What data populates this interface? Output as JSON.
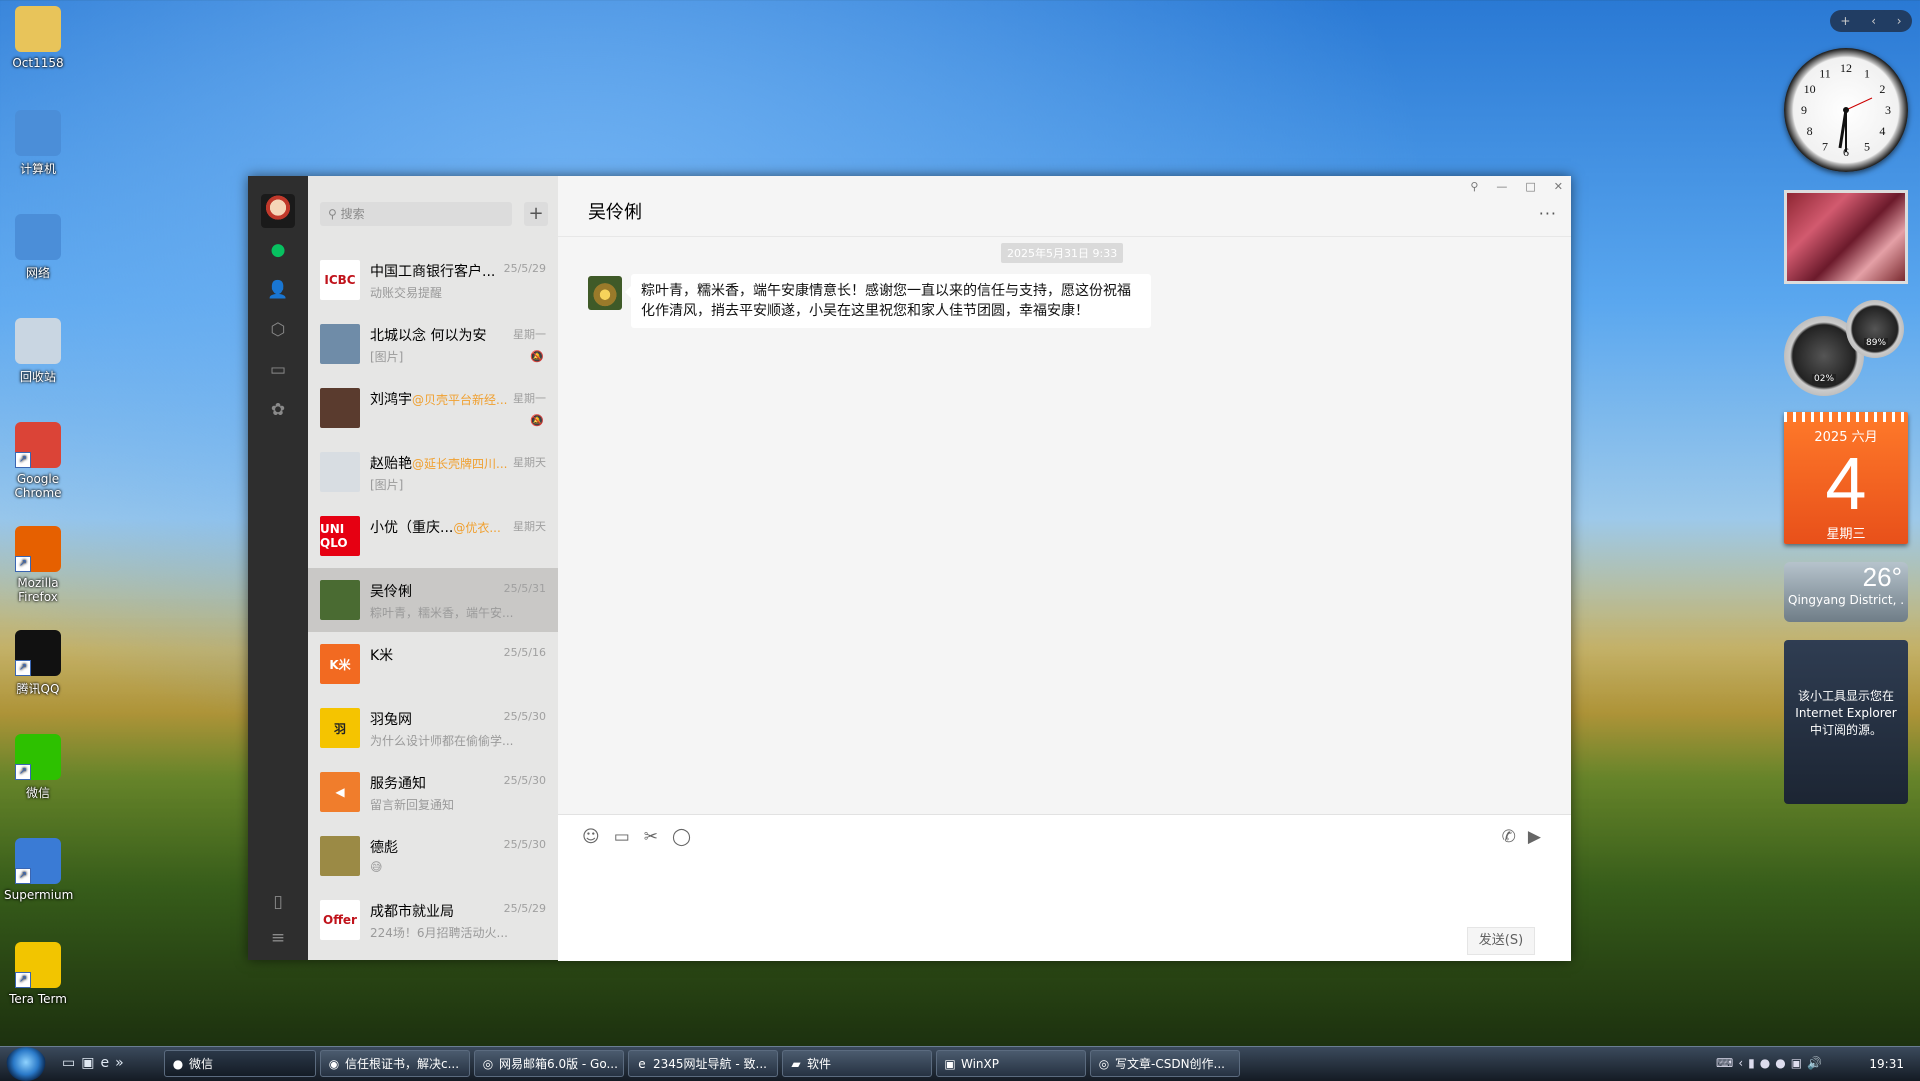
{
  "desktop": {
    "icons": [
      {
        "label": "Oct1158",
        "icon": "folder-icon",
        "color": "#e8c45a"
      },
      {
        "label": "计算机",
        "icon": "computer-icon",
        "color": "#4b8ed8"
      },
      {
        "label": "网络",
        "icon": "network-icon",
        "color": "#4b8ed8"
      },
      {
        "label": "回收站",
        "icon": "recycle-bin-icon",
        "color": "#c9d6e2"
      },
      {
        "label": "Google Chrome",
        "icon": "chrome-icon",
        "color": "#db4437"
      },
      {
        "label": "Mozilla Firefox",
        "icon": "firefox-icon",
        "color": "#e66000"
      },
      {
        "label": "腾讯QQ",
        "icon": "qq-icon",
        "color": "#111111"
      },
      {
        "label": "微信",
        "icon": "wechat-icon",
        "color": "#2dc100"
      },
      {
        "label": "Supermium",
        "icon": "supermium-icon",
        "color": "#3a7bd5"
      },
      {
        "label": "Tera Term",
        "icon": "teraterm-icon",
        "color": "#f2c500"
      }
    ]
  },
  "gadgets": {
    "clock": {
      "numbers": [
        "12",
        "1",
        "2",
        "3",
        "4",
        "5",
        "6",
        "7",
        "8",
        "9",
        "10",
        "11"
      ]
    },
    "meter": {
      "cpu": "02%",
      "mem": "89%"
    },
    "calendar": {
      "year_month": "2025 六月",
      "day": "4",
      "weekday": "星期三"
    },
    "weather": {
      "temp": "26°",
      "location": "Qingyang District, ..."
    },
    "feed": {
      "text": "该小工具显示您在 Internet Explorer 中订阅的源。"
    },
    "toolbar": {
      "add": "+",
      "prev": "‹",
      "next": "›"
    }
  },
  "wechat": {
    "search_placeholder": "搜索",
    "add_label": "+",
    "conversations": [
      {
        "name": "中国工商银行客户...",
        "highlight": "",
        "time": "25/5/29",
        "preview": "动账交易提醒",
        "avatar_text": "ICBC",
        "avatar_color": "#ffffff",
        "avatar_fg": "#c0131b",
        "muted": false
      },
      {
        "name": "北城以念 何以为安",
        "highlight": "",
        "time": "星期一",
        "preview": "[图片]",
        "avatar_text": "",
        "avatar_color": "#6f8ca8",
        "avatar_fg": "#ffffff",
        "muted": true
      },
      {
        "name": "刘鸿宇",
        "highlight": "@贝壳平台新经...",
        "time": "星期一",
        "preview": "",
        "avatar_text": "",
        "avatar_color": "#5a3b2e",
        "avatar_fg": "#ffffff",
        "muted": true
      },
      {
        "name": "赵贻艳",
        "highlight": "@延长壳牌四川...",
        "time": "星期天",
        "preview": "[图片]",
        "avatar_text": "",
        "avatar_color": "#d8dde2",
        "avatar_fg": "#c0392b",
        "muted": false
      },
      {
        "name": "小优（重庆...",
        "highlight": "@优衣...",
        "time": "星期天",
        "preview": "",
        "avatar_text": "UNI QLO",
        "avatar_color": "#e60012",
        "avatar_fg": "#ffffff",
        "muted": false
      },
      {
        "name": "吴伶俐",
        "highlight": "",
        "time": "25/5/31",
        "preview": "粽叶青，糯米香，端午安...",
        "avatar_text": "",
        "avatar_color": "#4a6b32",
        "avatar_fg": "#ffffff",
        "muted": false
      },
      {
        "name": "K米",
        "highlight": "",
        "time": "25/5/16",
        "preview": "",
        "avatar_text": "K米",
        "avatar_color": "#f26a21",
        "avatar_fg": "#ffffff",
        "muted": false
      },
      {
        "name": "羽兔网",
        "highlight": "",
        "time": "25/5/30",
        "preview": "为什么设计师都在偷偷学...",
        "avatar_text": "羽",
        "avatar_color": "#f5c400",
        "avatar_fg": "#222222",
        "muted": false
      },
      {
        "name": "服务通知",
        "highlight": "",
        "time": "25/5/30",
        "preview": "留言新回复通知",
        "avatar_text": "◀",
        "avatar_color": "#f07d2c",
        "avatar_fg": "#ffffff",
        "muted": false
      },
      {
        "name": "德彪",
        "highlight": "",
        "time": "25/5/30",
        "preview": "😅",
        "avatar_text": "",
        "avatar_color": "#9b8a45",
        "avatar_fg": "#ffffff",
        "muted": false
      },
      {
        "name": "成都市就业局",
        "highlight": "",
        "time": "25/5/29",
        "preview": "224场！6月招聘活动火...",
        "avatar_text": "Offer",
        "avatar_color": "#ffffff",
        "avatar_fg": "#c0131b",
        "muted": false
      }
    ],
    "chat": {
      "title": "吴伶俐",
      "timestamp": "2025年5月31日 9:33",
      "message": "粽叶青，糯米香，端午安康情意长！感谢您一直以来的信任与支持，愿这份祝福化作清风，捎去平安顺遂，小吴在这里祝您和家人佳节团圆，幸福安康！",
      "send_label": "发送(S)",
      "more_label": "···"
    }
  },
  "taskbar": {
    "tasks": [
      {
        "label": "微信",
        "icon": "wechat-icon"
      },
      {
        "label": "信任根证书，解决c...",
        "icon": "firefox-icon"
      },
      {
        "label": "网易邮箱6.0版 - Go...",
        "icon": "chrome-icon"
      },
      {
        "label": "2345网址导航 - 致...",
        "icon": "ie-icon"
      },
      {
        "label": "软件",
        "icon": "folder-icon"
      },
      {
        "label": "WinXP",
        "icon": "vm-icon"
      },
      {
        "label": "写文章-CSDN创作...",
        "icon": "chrome-icon"
      }
    ],
    "time": "19:31"
  }
}
